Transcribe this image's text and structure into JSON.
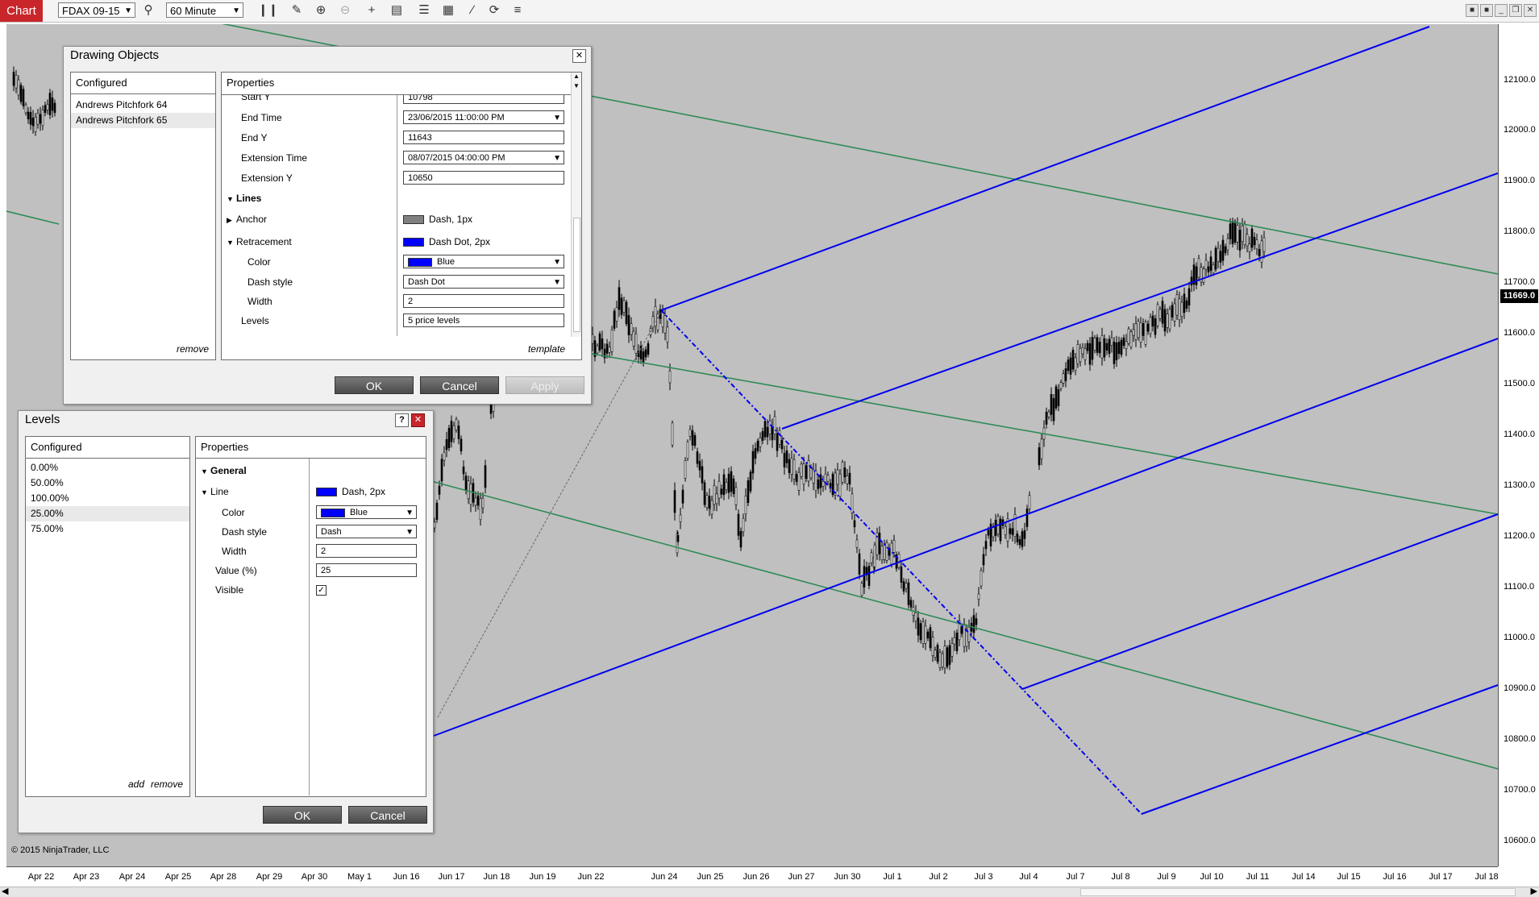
{
  "toolbar": {
    "tab_label": "Chart",
    "instrument": "FDAX 09-15",
    "interval": "60 Minute",
    "icons": [
      "magnifier-icon",
      "bar-type-icon",
      "pencil-icon",
      "zoom-in-icon",
      "zoom-out-icon",
      "crosshair-icon",
      "data-box-icon",
      "strategy-icon",
      "indicator-icon",
      "drawing-tools-icon",
      "refresh-icon",
      "properties-icon"
    ]
  },
  "chart": {
    "copyright": "© 2015 NinjaTrader, LLC",
    "background": "#c0c0c0",
    "price_labels": [
      "12100.0",
      "12000.0",
      "11900.0",
      "11800.0",
      "11700.0",
      "11600.0",
      "11500.0",
      "11400.0",
      "11300.0",
      "11200.0",
      "11100.0",
      "11000.0",
      "10900.0",
      "10800.0",
      "10700.0",
      "10600.0"
    ],
    "current_price": "11669.0",
    "time_labels": [
      "Apr 22",
      "Apr 23",
      "Apr 24",
      "Apr 25",
      "Apr 28",
      "Apr 29",
      "Apr 30",
      "May 1",
      "Jun 16",
      "Jun 17",
      "Jun 18",
      "Jun 19",
      "Jun 22",
      "Jun 24",
      "Jun 25",
      "Jun 26",
      "Jun 27",
      "Jun 30",
      "Jul 1",
      "Jul 2",
      "Jul 3",
      "Jul 4",
      "Jul 7",
      "Jul 8",
      "Jul 9",
      "Jul 10",
      "Jul 11",
      "Jul 14",
      "Jul 15",
      "Jul 16",
      "Jul 17",
      "Jul 18"
    ],
    "colors": {
      "pitchfork_blue": "#0000ee",
      "retracement_green": "#2e8b57",
      "candles": "#000000"
    }
  },
  "drawing_objects": {
    "title": "Drawing Objects",
    "configured_header": "Configured",
    "configured_items": [
      "Andrews Pitchfork 64",
      "Andrews Pitchfork 65"
    ],
    "selected_index": 1,
    "remove_link": "remove",
    "properties_header": "Properties",
    "template_link": "template",
    "rows": {
      "start_y": {
        "label": "Start Y",
        "value": "10798"
      },
      "end_time": {
        "label": "End Time",
        "value": "23/06/2015 11:00:00 PM"
      },
      "end_y": {
        "label": "End Y",
        "value": "11643"
      },
      "extension_time": {
        "label": "Extension  Time",
        "value": "08/07/2015 04:00:00 PM"
      },
      "extension_y": {
        "label": "Extension  Y",
        "value": "10650"
      },
      "lines": {
        "label": "Lines"
      },
      "anchor": {
        "label": "Anchor",
        "value": "Dash, 1px",
        "color": "#808080"
      },
      "retracement": {
        "label": "Retracement",
        "value": "Dash Dot, 2px",
        "color": "#0000ff"
      },
      "color": {
        "label": "Color",
        "value": "Blue",
        "color": "#0000ff"
      },
      "dash_style": {
        "label": "Dash style",
        "value": "Dash Dot"
      },
      "width": {
        "label": "Width",
        "value": "2"
      },
      "levels": {
        "label": "Levels",
        "value": "5 price levels"
      }
    },
    "buttons": {
      "ok": "OK",
      "cancel": "Cancel",
      "apply": "Apply"
    }
  },
  "levels": {
    "title": "Levels",
    "help_label": "?",
    "configured_header": "Configured",
    "configured_items": [
      "0.00%",
      "50.00%",
      "100.00%",
      "25.00%",
      "75.00%"
    ],
    "selected_index": 3,
    "add_link": "add",
    "remove_link": "remove",
    "properties_header": "Properties",
    "rows": {
      "general": {
        "label": "General"
      },
      "line": {
        "label": "Line",
        "value": "Dash, 2px",
        "color": "#0000ff"
      },
      "color": {
        "label": "Color",
        "value": "Blue",
        "color": "#0000ff"
      },
      "dash_style": {
        "label": "Dash style",
        "value": "Dash"
      },
      "width": {
        "label": "Width",
        "value": "2"
      },
      "value": {
        "label": "Value (%)",
        "value": "25"
      },
      "visible": {
        "label": "Visible",
        "checked": true
      }
    },
    "buttons": {
      "ok": "OK",
      "cancel": "Cancel"
    }
  }
}
